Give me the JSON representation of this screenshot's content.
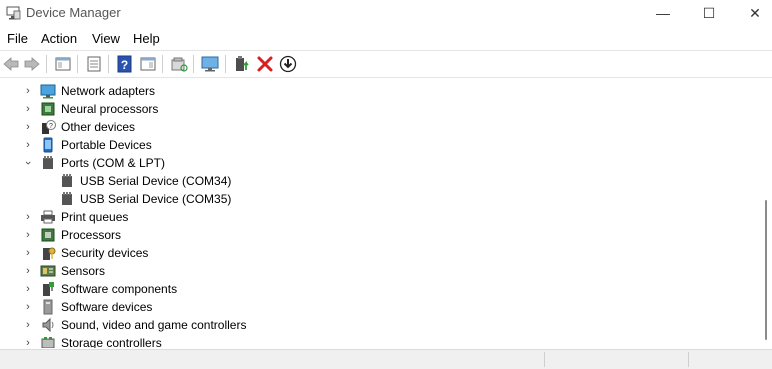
{
  "window": {
    "title": "Device Manager",
    "minimize_glyph": "—",
    "maximize_glyph": "☐",
    "close_glyph": "✕"
  },
  "menu": {
    "items": [
      {
        "label": "File"
      },
      {
        "label": "Action"
      },
      {
        "label": "View"
      },
      {
        "label": "Help"
      }
    ]
  },
  "toolbar": {
    "buttons": [
      {
        "icon": "back-arrow-icon"
      },
      {
        "icon": "forward-arrow-icon"
      },
      {
        "icon": "show-hide-console-tree-icon"
      },
      {
        "icon": "properties-icon"
      },
      {
        "icon": "help-icon"
      },
      {
        "icon": "action-pane-icon"
      },
      {
        "icon": "scan-hardware-icon"
      },
      {
        "icon": "monitor-icon"
      },
      {
        "icon": "update-driver-icon"
      },
      {
        "icon": "uninstall-device-icon"
      },
      {
        "icon": "download-driver-icon"
      }
    ]
  },
  "tree": {
    "items": [
      {
        "label": "Network adapters",
        "expanded": false,
        "icon": "network-adapter-icon"
      },
      {
        "label": "Neural processors",
        "expanded": false,
        "icon": "chip-icon"
      },
      {
        "label": "Other devices",
        "expanded": false,
        "icon": "unknown-device-icon"
      },
      {
        "label": "Portable Devices",
        "expanded": false,
        "icon": "portable-device-icon"
      },
      {
        "label": "Ports (COM & LPT)",
        "expanded": true,
        "icon": "port-icon"
      },
      {
        "label": "USB Serial Device (COM34)",
        "child": true,
        "icon": "port-icon"
      },
      {
        "label": "USB Serial Device (COM35)",
        "child": true,
        "icon": "port-icon"
      },
      {
        "label": "Print queues",
        "expanded": false,
        "icon": "printer-icon"
      },
      {
        "label": "Processors",
        "expanded": false,
        "icon": "processor-icon"
      },
      {
        "label": "Security devices",
        "expanded": false,
        "icon": "security-key-icon"
      },
      {
        "label": "Sensors",
        "expanded": false,
        "icon": "sensor-icon"
      },
      {
        "label": "Software components",
        "expanded": false,
        "icon": "software-component-icon"
      },
      {
        "label": "Software devices",
        "expanded": false,
        "icon": "software-device-icon"
      },
      {
        "label": "Sound, video and game controllers",
        "expanded": false,
        "icon": "speaker-icon"
      },
      {
        "label": "Storage controllers",
        "expanded": false,
        "icon": "storage-controller-icon"
      }
    ]
  },
  "colors": {
    "accent_blue": "#1e6fc7",
    "uninstall_red": "#d61f1f",
    "update_green": "#2c9e3a"
  }
}
